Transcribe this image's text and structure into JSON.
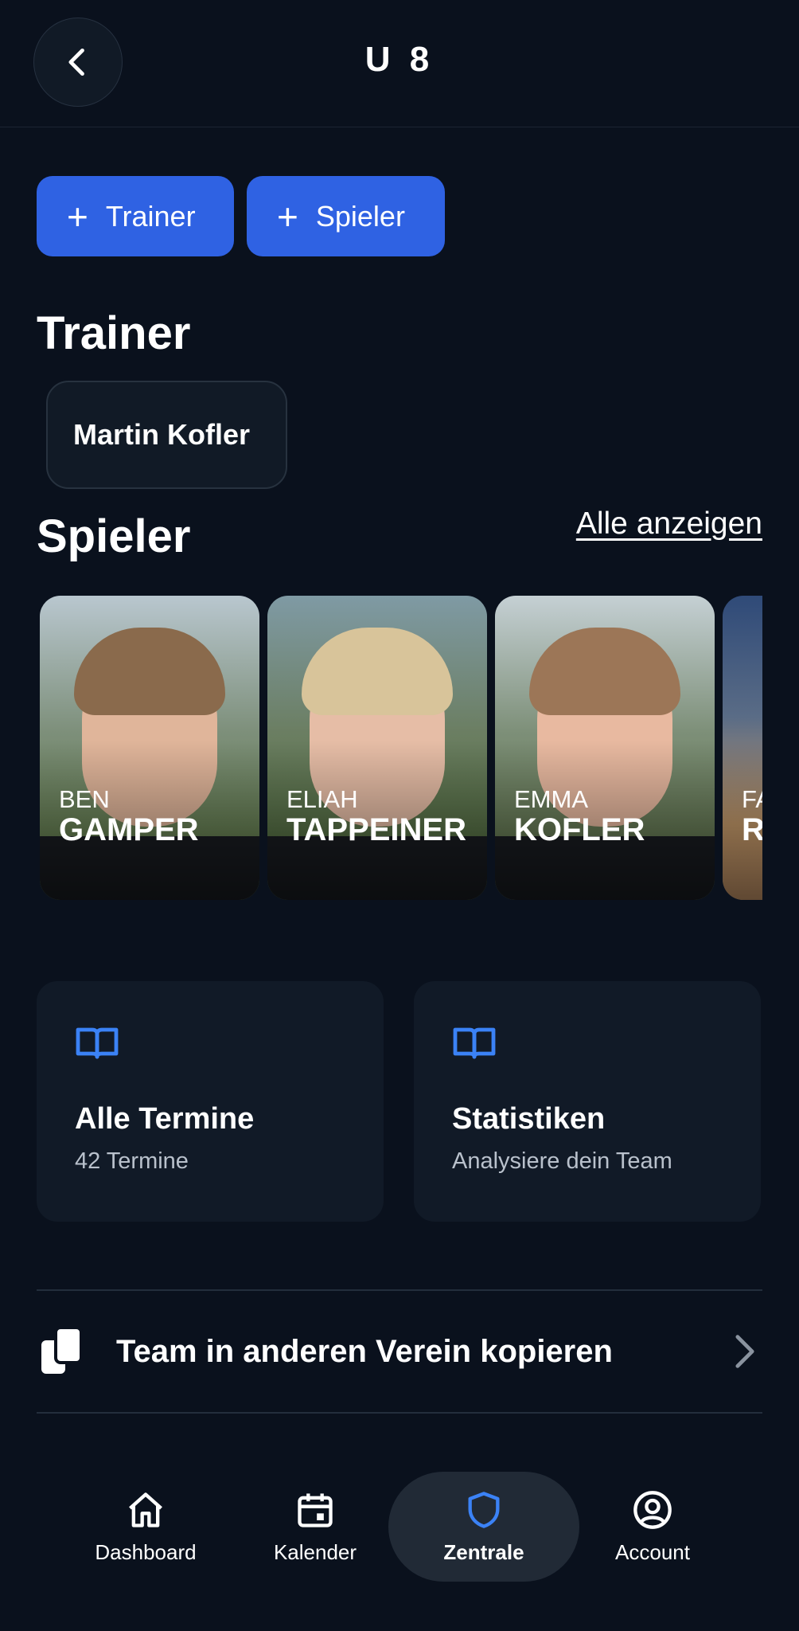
{
  "header": {
    "title": "U 8"
  },
  "actions": {
    "add_trainer": "Trainer",
    "add_spieler": "Spieler"
  },
  "trainer_section": {
    "heading": "Trainer",
    "trainers": [
      "Martin Kofler"
    ]
  },
  "spieler_section": {
    "heading": "Spieler",
    "show_all": "Alle anzeigen",
    "players": [
      {
        "first": "BEN",
        "last": "GAMPER"
      },
      {
        "first": "ELIAH",
        "last": "TAPPEINER"
      },
      {
        "first": "EMMA",
        "last": "KOFLER"
      },
      {
        "first": "FA",
        "last": "R"
      }
    ]
  },
  "tiles": [
    {
      "title": "Alle Termine",
      "subtitle": "42 Termine",
      "icon": "book-open-icon"
    },
    {
      "title": "Statistiken",
      "subtitle": "Analysiere dein Team",
      "icon": "book-open-icon"
    }
  ],
  "copy_row": {
    "label": "Team in anderen Verein kopieren",
    "icon": "copy-icon"
  },
  "nav": [
    {
      "label": "Dashboard",
      "icon": "home-icon",
      "active": false
    },
    {
      "label": "Kalender",
      "icon": "calendar-icon",
      "active": false
    },
    {
      "label": "Zentrale",
      "icon": "shield-icon",
      "active": true
    },
    {
      "label": "Account",
      "icon": "user-circle-icon",
      "active": false
    }
  ],
  "colors": {
    "background": "#0a111d",
    "primary": "#2f62e3",
    "card": "#111a27",
    "accent_icon": "#3b82f6"
  }
}
